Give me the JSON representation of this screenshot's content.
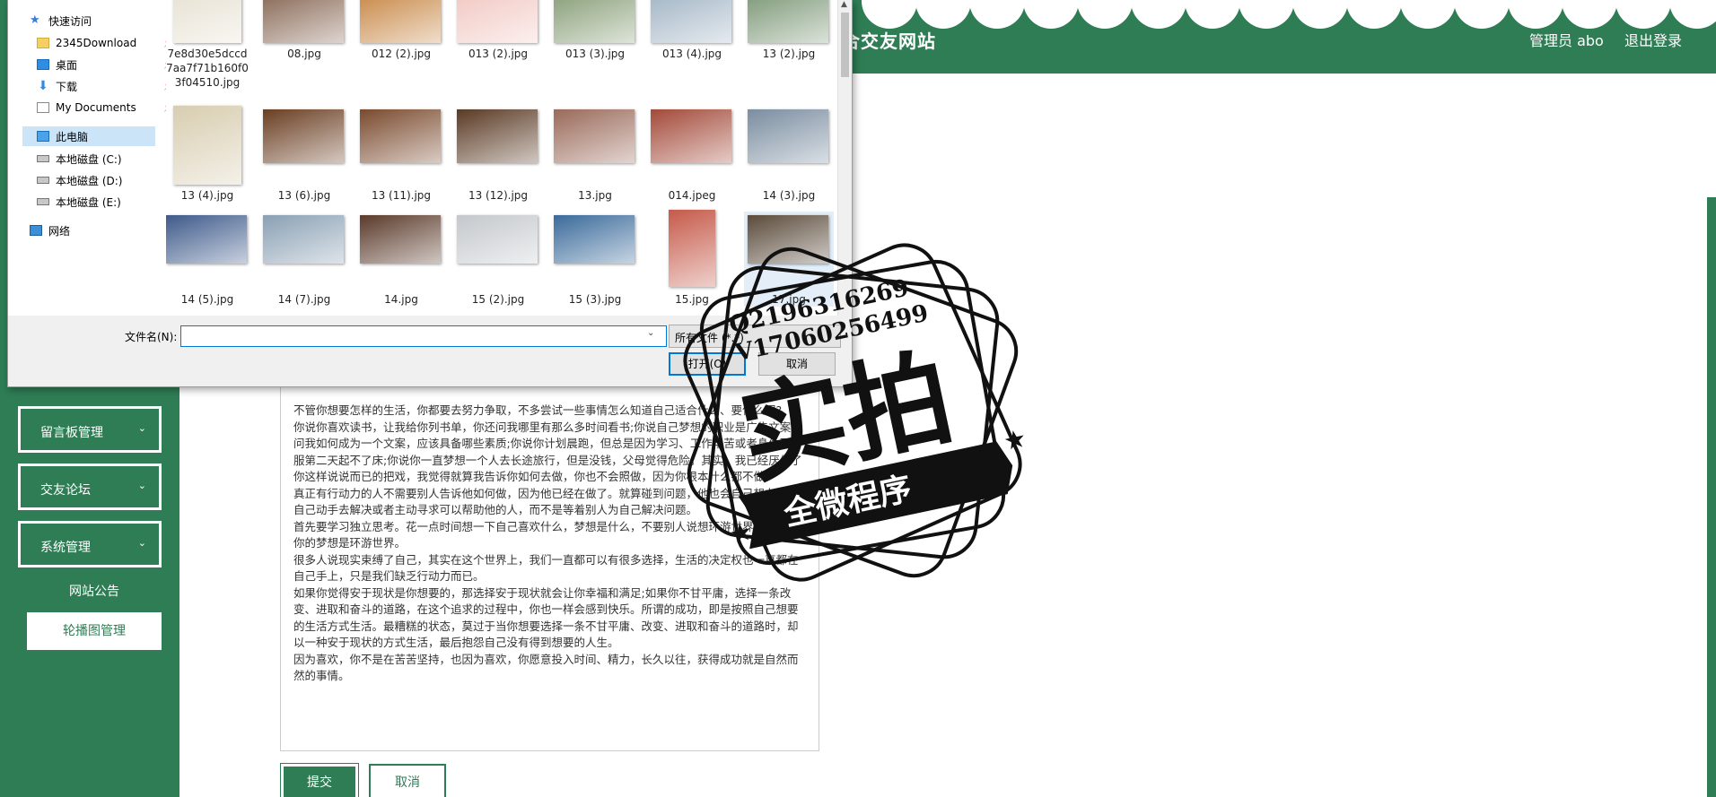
{
  "app": {
    "site_title": "合交友网站",
    "admin_label": "管理员 abo",
    "logout_label": "退出登录"
  },
  "sidebar": {
    "menus": [
      {
        "label": "留言板管理",
        "chevron": "⌄"
      },
      {
        "label": "交友论坛",
        "chevron": "⌄"
      },
      {
        "label": "系统管理",
        "chevron": "⌄"
      }
    ],
    "submenus": [
      {
        "label": "网站公告"
      },
      {
        "label": "轮播图管理"
      }
    ]
  },
  "editor": {
    "lines": [
      "不管你想要怎样的生活，你都要去努力争取，不多尝试一些事情怎么知道自己适合什么、要什么呢?",
      "你说你喜欢读书，让我给你列书单，你还问我哪里有那么多时间看书;你说自己梦想的职业是广告文案，问我如何成为一个文案，应该具备哪些素质;你说你计划晨跑，但总是因为学习、工作辛苦或者身体不舒服第二天起不了床;你说你一直梦想一个人去长途旅行，但是没钱，父母觉得危险。其实，我已经厌倦了你这样说说而已的把戏，我觉得就算我告诉你如何去做，你也不会照做，因为你根本什么都不做。",
      "真正有行动力的人不需要别人告诉他如何做，因为他已经在做了。就算碰到问题，他也会自己想办法，自己动手去解决或者主动寻求可以帮助他的人，而不是等着别人为自己解决问题。",
      "首先要学习独立思考。花一点时间想一下自己喜欢什么，梦想是什么，不要别人说想环游世界，你就说你的梦想是环游世界。",
      "很多人说现实束缚了自己，其实在这个世界上，我们一直都可以有很多选择，生活的决定权也一直都在自己手上，只是我们缺乏行动力而已。",
      "如果你觉得安于现状是你想要的，那选择安于现状就会让你幸福和满足;如果你不甘平庸，选择一条改变、进取和奋斗的道路，在这个追求的过程中，你也一样会感到快乐。所谓的成功，即是按照自己想要的生活方式生活。最糟糕的状态，莫过于当你想要选择一条不甘平庸、改变、进取和奋斗的道路时，却以一种安于现状的方式生活，最后抱怨自己没有得到想要的人生。",
      "因为喜欢，你不是在苦苦坚持，也因为喜欢，你愿意投入时间、精力，长久以往，获得成功就是自然而然的事情。"
    ],
    "submit_label": "提交",
    "cancel_label": "取消"
  },
  "dialog": {
    "nav": {
      "quick_access": "快速访问",
      "items": [
        {
          "label": "2345Download",
          "icon": "folder-icon",
          "pinned": true
        },
        {
          "label": "桌面",
          "icon": "desktop-icon",
          "pinned": true
        },
        {
          "label": "下载",
          "icon": "download-icon",
          "pinned": true
        },
        {
          "label": "My Documents",
          "icon": "documents-icon",
          "pinned": true
        }
      ],
      "this_pc": "此电脑",
      "drives": [
        "本地磁盘 (C:)",
        "本地磁盘 (D:)",
        "本地磁盘 (E:)"
      ],
      "network": "网络",
      "pin_glyph": "📌"
    },
    "files": [
      {
        "name": "7e8d30e5dccd7aa7f71b160f03f04510.jpg",
        "color": "#e8e2d4"
      },
      {
        "name": "08.jpg",
        "color": "#8a6a58"
      },
      {
        "name": "012 (2).jpg",
        "color": "#c98a4a"
      },
      {
        "name": "013 (2).jpg",
        "color": "#f2c9c4"
      },
      {
        "name": "013 (3).jpg",
        "color": "#8aa07a"
      },
      {
        "name": "013 (4).jpg",
        "color": "#a4b6c6"
      },
      {
        "name": "13 (2).jpg",
        "color": "#7f9a7a"
      },
      {
        "name": "13 (4).jpg",
        "color": "#d8cdb0"
      },
      {
        "name": "13 (6).jpg",
        "color": "#6a3e22"
      },
      {
        "name": "13 (11).jpg",
        "color": "#7a4a2e"
      },
      {
        "name": "13 (12).jpg",
        "color": "#5a3a24"
      },
      {
        "name": "13.jpg",
        "color": "#9a6a5a"
      },
      {
        "name": "014.jpeg",
        "color": "#a34a3a"
      },
      {
        "name": "14 (3).jpg",
        "color": "#7a8da0"
      },
      {
        "name": "14 (5).jpg",
        "color": "#3e5a8a"
      },
      {
        "name": "14 (7).jpg",
        "color": "#8aa0b4"
      },
      {
        "name": "14.jpg",
        "color": "#5a3a2a"
      },
      {
        "name": "15 (2).jpg",
        "color": "#c4c8cc"
      },
      {
        "name": "15 (3).jpg",
        "color": "#3a6a9a"
      },
      {
        "name": "15.jpg",
        "color": "#c65a4a"
      },
      {
        "name": "17.jpg",
        "color": "#5a4a3a"
      }
    ],
    "filename_label": "文件名(N):",
    "filename_value": "",
    "filetype_value": "所有文件 (*.*)",
    "open_label": "打开(O)",
    "cancel_label": "取消"
  },
  "watermark": {
    "qq": "Q2196316269",
    "wechat": "V17060256499",
    "big_text": "实拍",
    "ribbon_text": "全微程序"
  },
  "colors": {
    "brand_green": "#2e7d55",
    "dialog_bg": "#f0f0f0",
    "selection_blue": "#0078d7"
  }
}
